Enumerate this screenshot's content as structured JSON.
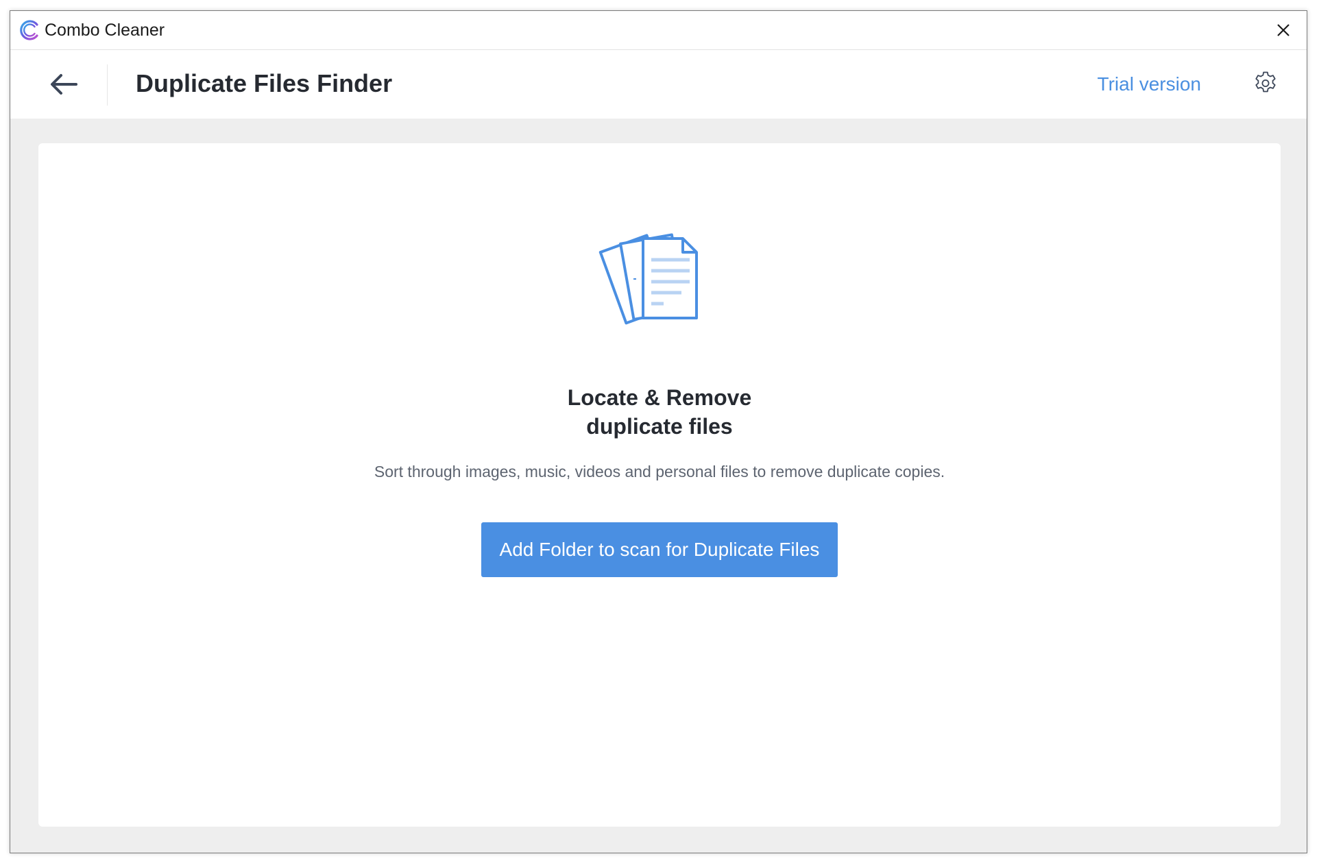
{
  "window": {
    "app_title": "Combo Cleaner",
    "logo_icon": "combo-cleaner-logo-icon",
    "close_icon": "close-icon"
  },
  "header": {
    "back_icon": "arrow-left-icon",
    "title": "Duplicate Files Finder",
    "trial_label": "Trial version",
    "settings_icon": "gear-icon"
  },
  "main": {
    "illustration_icon": "documents-stack-icon",
    "headline_line1": "Locate & Remove",
    "headline_line2": "duplicate files",
    "description": "Sort through images, music, videos and personal files to remove duplicate copies.",
    "button_label": "Add Folder to scan for Duplicate Files"
  },
  "colors": {
    "accent": "#4a8fe2",
    "link": "#4a8fe0",
    "title_text": "#262a31",
    "muted_text": "#5d6470",
    "background": "#eeeeee"
  }
}
